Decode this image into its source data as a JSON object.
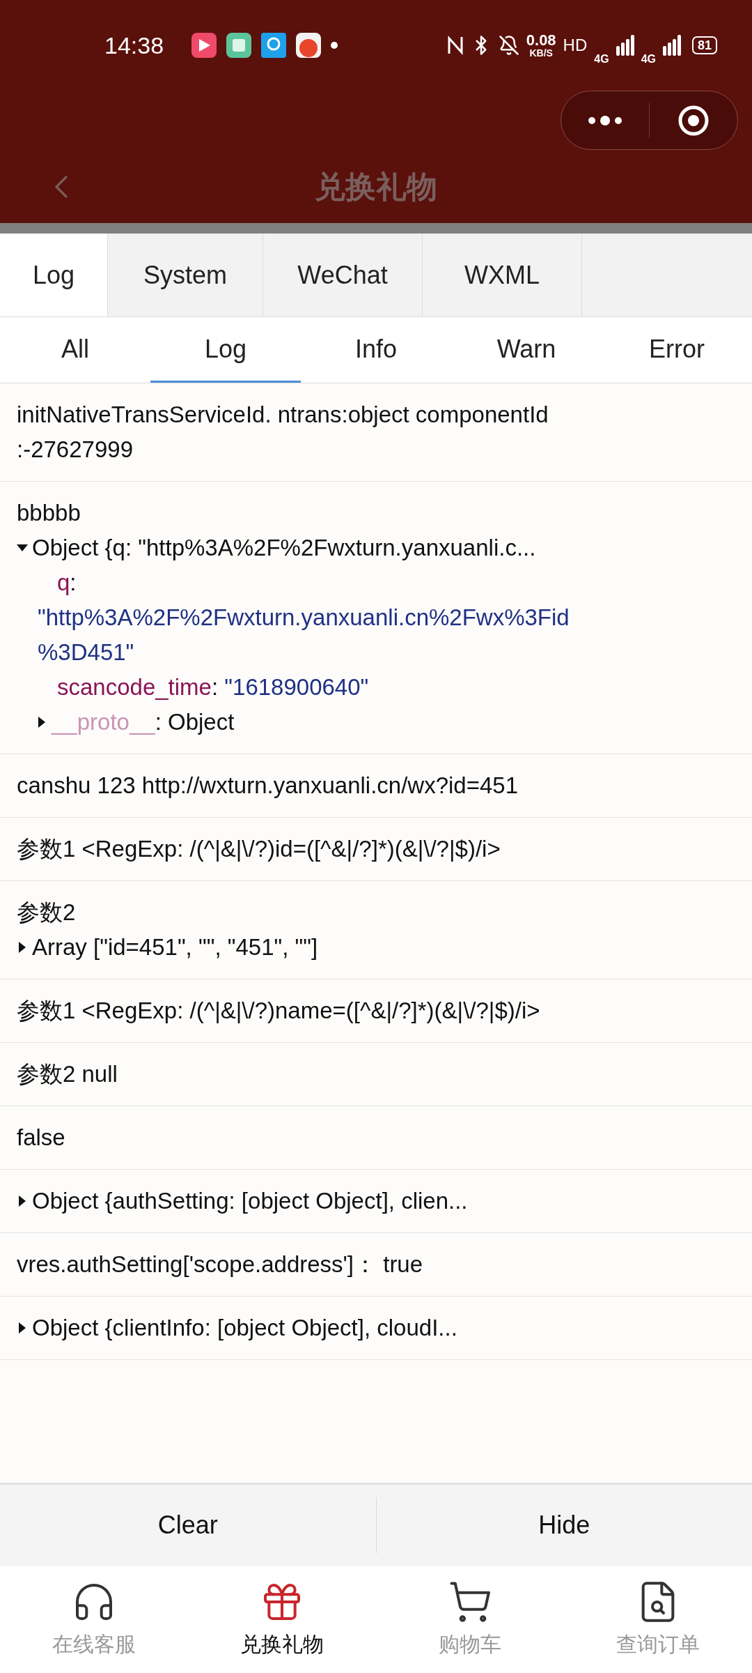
{
  "status_bar": {
    "time": "14:38",
    "network_speed": "0.08",
    "speed_unit": "KB/S",
    "hd": "HD",
    "signal_1": "4G",
    "signal_2": "4G",
    "battery": "81"
  },
  "header": {
    "title": "兑换礼物"
  },
  "top_tabs": [
    {
      "label": "Log",
      "selected": true
    },
    {
      "label": "System",
      "selected": false
    },
    {
      "label": "WeChat",
      "selected": false
    },
    {
      "label": "WXML",
      "selected": false
    }
  ],
  "filter_tabs": [
    {
      "label": "All",
      "selected": false
    },
    {
      "label": "Log",
      "selected": true
    },
    {
      "label": "Info",
      "selected": false
    },
    {
      "label": "Warn",
      "selected": false
    },
    {
      "label": "Error",
      "selected": false
    }
  ],
  "log_entries": [
    {
      "items": [
        {
          "kind": "text",
          "text": "initNativeTransServiceId. ntrans:object componentId :-27627999"
        }
      ]
    },
    {
      "items": [
        {
          "kind": "text",
          "text": "bbbbb"
        },
        {
          "kind": "object",
          "expanded": true,
          "summary": "Object {q: \"http%3A%2F%2Fwxturn.yanxuanli.c...",
          "properties": [
            {
              "kind": "field",
              "key": "q",
              "separator": ":",
              "value": "\"http%3A%2F%2Fwxturn.yanxuanli.cn%2Fwx%3Fid%3D451\""
            },
            {
              "kind": "field",
              "key": "scancode_time",
              "separator": ":",
              "value": "\"1618900640\""
            },
            {
              "kind": "proto",
              "key": "__proto__",
              "separator": ":",
              "value": "Object",
              "expanded": false
            }
          ]
        }
      ]
    },
    {
      "items": [
        {
          "kind": "text",
          "text": "canshu 123 http://wxturn.yanxuanli.cn/wx?id=451"
        }
      ]
    },
    {
      "items": [
        {
          "kind": "text",
          "text": "参数1 <RegExp: /(^|&|\\/?)id=([^&|/?]*)(&|\\/?|$)/i>"
        }
      ]
    },
    {
      "items": [
        {
          "kind": "text",
          "text": "参数2"
        },
        {
          "kind": "object",
          "expanded": false,
          "summary": "Array [\"id=451\", \"\", \"451\", \"\"]"
        }
      ]
    },
    {
      "items": [
        {
          "kind": "text",
          "text": "参数1 <RegExp: /(^|&|\\/?)name=([^&|/?]*)(&|\\/?|$)/i>"
        }
      ]
    },
    {
      "items": [
        {
          "kind": "text",
          "text": "参数2 null"
        }
      ]
    },
    {
      "items": [
        {
          "kind": "text",
          "text": "false"
        }
      ]
    },
    {
      "items": [
        {
          "kind": "object",
          "expanded": false,
          "summary": "Object {authSetting: [object Object], clien..."
        }
      ]
    },
    {
      "items": [
        {
          "kind": "text",
          "text": "vres.authSetting['scope.address']： true"
        }
      ]
    },
    {
      "items": [
        {
          "kind": "object",
          "expanded": false,
          "summary": "Object {clientInfo: [object Object], cloudI..."
        }
      ]
    }
  ],
  "actions": [
    "Clear",
    "Hide"
  ],
  "bottom_nav": [
    {
      "label": "在线客服",
      "kind": "headset",
      "selected": false
    },
    {
      "label": "兑换礼物",
      "kind": "gift",
      "selected": true
    },
    {
      "label": "购物车",
      "kind": "cart",
      "selected": false
    },
    {
      "label": "查询订单",
      "kind": "order",
      "selected": false
    }
  ]
}
